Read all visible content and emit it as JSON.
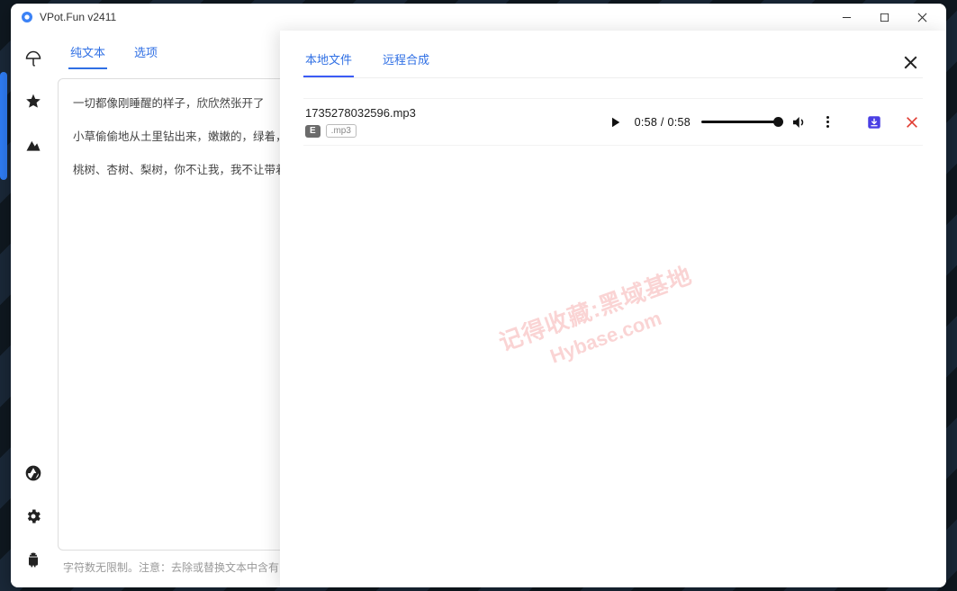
{
  "window": {
    "title": "VPot.Fun v2411"
  },
  "sidebar": {
    "items": [
      {
        "name": "umbrella-icon"
      },
      {
        "name": "star-icon"
      },
      {
        "name": "mountain-icon"
      }
    ],
    "bottom": [
      {
        "name": "aperture-icon"
      },
      {
        "name": "gear-icon"
      },
      {
        "name": "android-icon"
      }
    ]
  },
  "left_tabs": {
    "tab1": "纯文本",
    "tab2": "选项",
    "active": 0
  },
  "text_content": {
    "p1": "一切都像刚睡醒的样子，欣欣然张开了",
    "p2": "小草偷偷地从土里钻出来，嫩嫩的，绿着，打两个滚，踢几脚球，赛几趟跑，",
    "p3": "桃树、杏树、梨树，你不让我，我不让带着甜味儿；闭了眼，树上仿佛已经满蝴蝶飞来飞去。野花遍地是：杂样儿，的。"
  },
  "hint": "字符数无限制。注意：去除或替换文本中含有",
  "overlay_tabs": {
    "tab1": "本地文件",
    "tab2": "远程合成",
    "active": 0
  },
  "track": {
    "filename": "1735278032596.mp3",
    "badge_e": "E",
    "badge_ext": ".mp3",
    "time_label": "0:58 / 0:58"
  },
  "watermark": {
    "line1": "记得收藏:黑域基地",
    "line2": "Hybase.com"
  }
}
